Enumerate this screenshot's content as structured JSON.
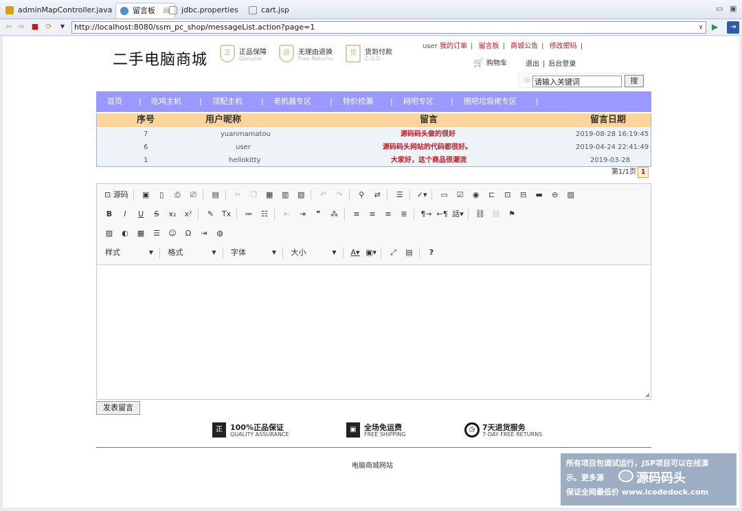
{
  "tabs": [
    {
      "label": "adminMapController.java",
      "color": "#d4a017"
    },
    {
      "label": "留言板",
      "color": "#4a8fd4",
      "close": "☒"
    },
    {
      "label": "jdbc.properties",
      "color": "#8a8a8a"
    },
    {
      "label": "cart.jsp",
      "color": "#8a8a8a"
    }
  ],
  "url": "http://localhost:8080/ssm_pc_shop/messageList.action?page=1",
  "header": {
    "logo": "二手电脑商城",
    "badges": [
      {
        "title": "正品保障",
        "sub": "Genuine",
        "glyph": "正"
      },
      {
        "title": "无理由退换",
        "sub": "Free Returns",
        "glyph": "退"
      },
      {
        "title": "货到付款",
        "sub": "C.O.D",
        "glyph": "货"
      }
    ],
    "username": "user",
    "links": [
      "我的订单",
      "留言板",
      "商城公告",
      "修改密码"
    ],
    "cart": "购物车",
    "logout": "退出",
    "admin_login": "后台登录",
    "search_value": "请输入关键词",
    "search_button": "搜"
  },
  "nav": [
    "首页",
    "吃鸡主机",
    "顶配主机",
    "老机器专区",
    "特价捡漏",
    "网吧专区",
    "图吧垃圾佬专区"
  ],
  "table": {
    "headers": [
      "序号",
      "用户昵称",
      "留言",
      "留言日期"
    ],
    "rows": [
      {
        "id": "7",
        "user": "yuanmamatou",
        "msg": "源码码头做的很好",
        "date": "2019-08-28 16:19:45"
      },
      {
        "id": "6",
        "user": "user",
        "msg": "源码码头网站的代码都很好。",
        "date": "2019-04-24 22:41:49"
      },
      {
        "id": "1",
        "user": "hellokitty",
        "msg": "大家好，这个商品很潮流",
        "date": "2019-03-28"
      }
    ]
  },
  "pager": {
    "text": "第1/1页",
    "current": "1"
  },
  "editor": {
    "source_label": "源码",
    "combos": [
      "样式",
      "格式",
      "字体",
      "大小"
    ]
  },
  "submit_button": "发表留言",
  "footer": {
    "services": [
      {
        "title": "100%正品保证",
        "sub": "QUALITY ASSURANCE",
        "glyph": "正"
      },
      {
        "title": "全场免运费",
        "sub": "FREE SHIPPING",
        "glyph": "▣"
      },
      {
        "title": "7天退货服务",
        "sub": "7-DAY FREE RETURNS",
        "glyph": "◷"
      }
    ],
    "site": "电脑商城网站"
  },
  "watermark": {
    "line1": "所有项目包调试运行，JSP项目可以在线演",
    "line2": "示。更多源",
    "brand": "源码码头",
    "line3": "保证全网最低价 www.icodedock.com"
  },
  "colors": {
    "accent_red": "#c8161d",
    "nav_bg": "#9999ff",
    "table_head": "#fdd59b"
  }
}
